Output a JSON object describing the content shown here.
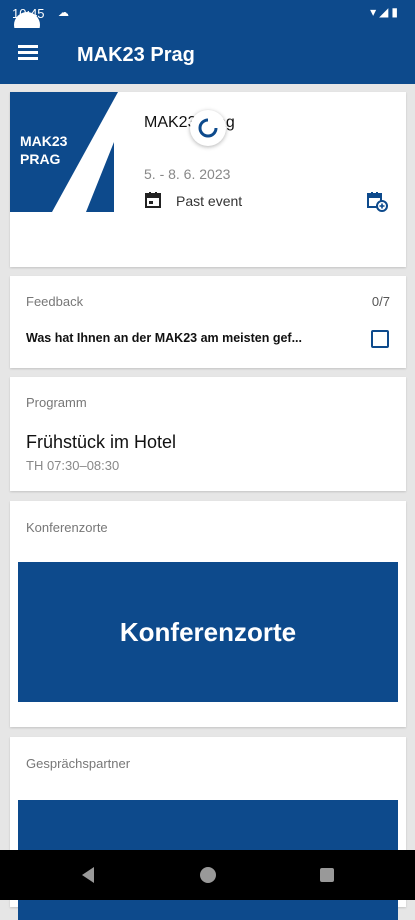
{
  "status": {
    "time": "10:45"
  },
  "app": {
    "title": "MAK23 Prag"
  },
  "event": {
    "logo_line1": "MAK23",
    "logo_line2": "PRAG",
    "title": "MAK23 Prag",
    "date": "5. - 8. 6. 2023",
    "status": "Past event"
  },
  "feedback": {
    "label": "Feedback",
    "count": "0/7",
    "question": "Was hat Ihnen an der MAK23 am meisten gef..."
  },
  "program": {
    "label": "Programm",
    "title": "Frühstück im Hotel",
    "time": "TH 07:30–08:30"
  },
  "venues": {
    "label": "Konferenzorte",
    "banner": "Konferenzorte"
  },
  "partners": {
    "label": "Gesprächspartner"
  },
  "colors": {
    "primary": "#0d4a8c",
    "background": "#e6e6e6"
  }
}
